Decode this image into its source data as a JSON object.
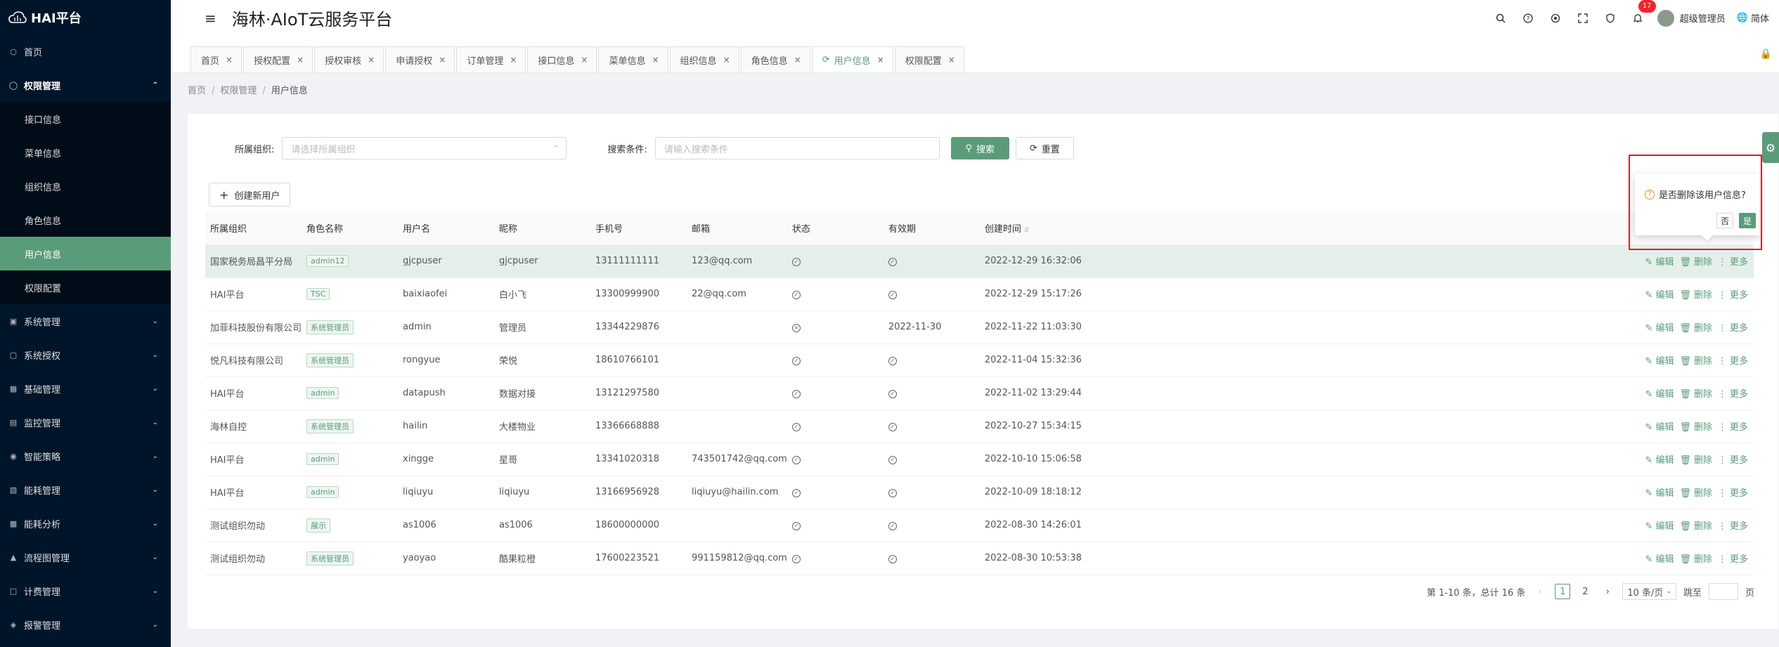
{
  "app": {
    "logo_text": "HAI平台",
    "title": "海林·AIoT云服务平台"
  },
  "sidebar": {
    "items": [
      {
        "label": "首页",
        "icon": "home-icon"
      },
      {
        "label": "权限管理",
        "icon": "shield-icon",
        "open": true,
        "children": [
          "接口信息",
          "菜单信息",
          "组织信息",
          "角色信息",
          "用户信息",
          "权限配置"
        ],
        "active_child": "用户信息"
      },
      {
        "label": "系统管理",
        "icon": "system-icon"
      },
      {
        "label": "系统授权",
        "icon": "auth-icon"
      },
      {
        "label": "基础管理",
        "icon": "base-icon"
      },
      {
        "label": "监控管理",
        "icon": "monitor-icon"
      },
      {
        "label": "智能策略",
        "icon": "strategy-icon"
      },
      {
        "label": "能耗管理",
        "icon": "energy-icon"
      },
      {
        "label": "能耗分析",
        "icon": "chart-icon"
      },
      {
        "label": "流程图管理",
        "icon": "flow-icon"
      },
      {
        "label": "计费管理",
        "icon": "billing-icon"
      },
      {
        "label": "报警管理",
        "icon": "alarm-icon"
      }
    ]
  },
  "header": {
    "notification_count": "17",
    "user_name": "超级管理员",
    "language": "简体"
  },
  "tabs": [
    {
      "label": "首页"
    },
    {
      "label": "授权配置"
    },
    {
      "label": "授权审核"
    },
    {
      "label": "申请授权"
    },
    {
      "label": "订单管理"
    },
    {
      "label": "接口信息"
    },
    {
      "label": "菜单信息"
    },
    {
      "label": "组织信息"
    },
    {
      "label": "角色信息"
    },
    {
      "label": "用户信息",
      "active": true
    },
    {
      "label": "权限配置"
    }
  ],
  "breadcrumb": [
    "首页",
    "权限管理",
    "用户信息"
  ],
  "search": {
    "org_label": "所属组织:",
    "org_placeholder": "请选择所属组织",
    "cond_label": "搜索条件:",
    "cond_placeholder": "请输入搜索条件",
    "search_button": "搜索",
    "reset_button": "重置"
  },
  "create_button": "创建新用户",
  "table": {
    "columns": [
      "所属组织",
      "角色名称",
      "用户名",
      "昵称",
      "手机号",
      "邮箱",
      "状态",
      "有效期",
      "创建时间"
    ],
    "rows": [
      {
        "org": "国家税务局昌平分局",
        "role": "admin12",
        "username": "gjcpuser",
        "nickname": "gjcpuser",
        "phone": "13111111111",
        "email": "123@qq.com",
        "status": "ok",
        "valid": "ok",
        "created": "2022-12-29 16:32:06"
      },
      {
        "org": "HAI平台",
        "role": "TSC",
        "username": "baixiaofei",
        "nickname": "白小飞",
        "phone": "13300999900",
        "email": "22@qq.com",
        "status": "ok",
        "valid": "ok",
        "created": "2022-12-29 15:17:26"
      },
      {
        "org": "加菲科技股份有限公司",
        "role": "系统管理员",
        "username": "admin",
        "nickname": "管理员",
        "phone": "13344229876",
        "email": "",
        "status": "x",
        "valid": "2022-11-30",
        "created": "2022-11-22 11:03:30"
      },
      {
        "org": "悦凡科技有限公司",
        "role": "系统管理员",
        "username": "rongyue",
        "nickname": "荣悦",
        "phone": "18610766101",
        "email": "",
        "status": "ok",
        "valid": "ok",
        "created": "2022-11-04 15:32:36"
      },
      {
        "org": "HAI平台",
        "role": "admin",
        "username": "datapush",
        "nickname": "数据对接",
        "phone": "13121297580",
        "email": "",
        "status": "ok",
        "valid": "ok",
        "created": "2022-11-02 13:29:44"
      },
      {
        "org": "海林自控",
        "role": "系统管理员",
        "username": "hailin",
        "nickname": "大楼物业",
        "phone": "13366668888",
        "email": "",
        "status": "ok",
        "valid": "ok",
        "created": "2022-10-27 15:34:15"
      },
      {
        "org": "HAI平台",
        "role": "admin",
        "username": "xingge",
        "nickname": "星哥",
        "phone": "13341020318",
        "email": "743501742@qq.com",
        "status": "ok",
        "valid": "ok",
        "created": "2022-10-10 15:06:58"
      },
      {
        "org": "HAI平台",
        "role": "admin",
        "username": "liqiuyu",
        "nickname": "liqiuyu",
        "phone": "13166956928",
        "email": "liqiuyu@hailin.com",
        "status": "ok",
        "valid": "ok",
        "created": "2022-10-09 18:18:12"
      },
      {
        "org": "测试组织勿动",
        "role": "展示",
        "username": "as1006",
        "nickname": "as1006",
        "phone": "18600000000",
        "email": "",
        "status": "ok",
        "valid": "ok",
        "created": "2022-08-30 14:26:01"
      },
      {
        "org": "测试组织勿动",
        "role": "系统管理员",
        "username": "yaoyao",
        "nickname": "酷果粒橙",
        "phone": "17600223521",
        "email": "991159812@qq.com",
        "status": "ok",
        "valid": "ok",
        "created": "2022-08-30 10:53:38"
      }
    ],
    "actions": {
      "edit": "编辑",
      "delete": "删除",
      "more": "更多"
    }
  },
  "pagination": {
    "summary": "第 1-10 条，总计 16 条",
    "pages": [
      "1",
      "2"
    ],
    "current": "1",
    "page_size": "10 条/页",
    "jump_label": "跳至",
    "page_suffix": "页"
  },
  "popconfirm": {
    "message": "是否删除该用户信息?",
    "no": "否",
    "yes": "是"
  },
  "colors": {
    "primary": "#5a9c7a",
    "sidebar_bg": "#001529",
    "highlight": "#e01e1e"
  }
}
